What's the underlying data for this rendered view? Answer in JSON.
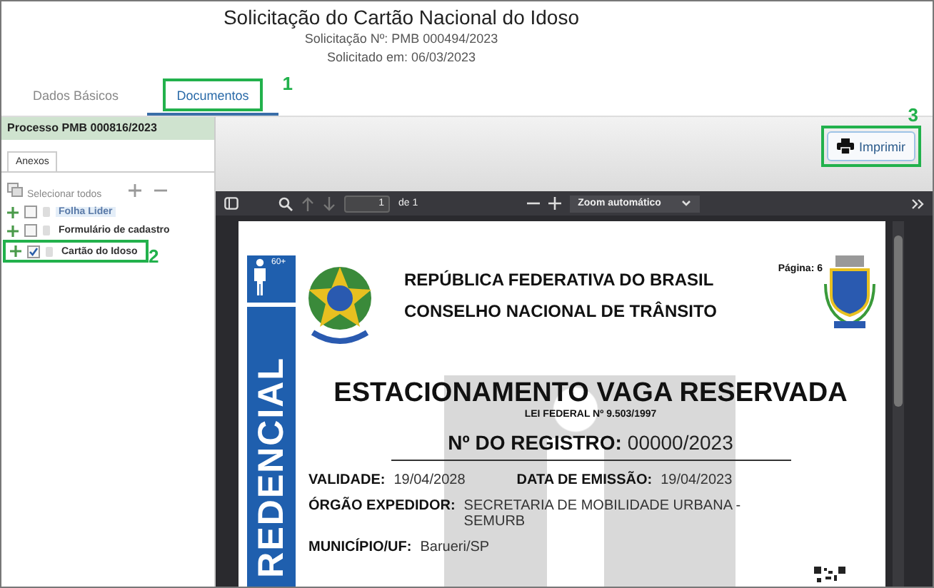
{
  "header": {
    "title": "Solicitação do Cartão Nacional do Idoso",
    "request_number": "Solicitação Nº: PMB 000494/2023",
    "requested_on": "Solicitado em: 06/03/2023"
  },
  "tabs": [
    {
      "label": "Dados Básicos",
      "selected": false
    },
    {
      "label": "Documentos",
      "selected": true,
      "callout": "1"
    }
  ],
  "sidebar": {
    "title": "Processo PMB 000816/2023",
    "tab": "Anexos",
    "select_all": "Selecionar todos",
    "items": [
      {
        "label": "Folha Lider",
        "checked": false,
        "selected": true
      },
      {
        "label": "Formulário de cadastro",
        "checked": false,
        "selected": false
      },
      {
        "label": "Cartão do Idoso",
        "checked": true,
        "selected": false,
        "callout": "2"
      }
    ]
  },
  "print_button": {
    "label": "Imprimir",
    "callout": "3"
  },
  "pdf_toolbar": {
    "page": "1",
    "page_count": "de 1",
    "zoom": "Zoom automático"
  },
  "document": {
    "badge_text": "60+",
    "page_label": "Página: 6",
    "lines": [
      "REPÚBLICA FEDERATIVA DO BRASIL",
      "CONSELHO NACIONAL DE TRÂNSITO"
    ],
    "side_label": "REDENCIAL",
    "title": "ESTACIONAMENTO VAGA RESERVADA",
    "law": "LEI FEDERAL Nº 9.503/1997",
    "registry_label": "Nº DO REGISTRO:",
    "registry_value": "00000/2023",
    "fields": [
      {
        "label": "VALIDADE:",
        "value": "19/04/2028"
      },
      {
        "label": "DATA DE EMISSÃO:",
        "value": "19/04/2023"
      },
      {
        "label": "ÓRGÃO EXPEDIDOR:",
        "value": "SECRETARIA DE MOBILIDADE URBANA - SEMURB"
      },
      {
        "label": "MUNICÍPIO/UF:",
        "value": "Barueri/SP"
      }
    ]
  }
}
